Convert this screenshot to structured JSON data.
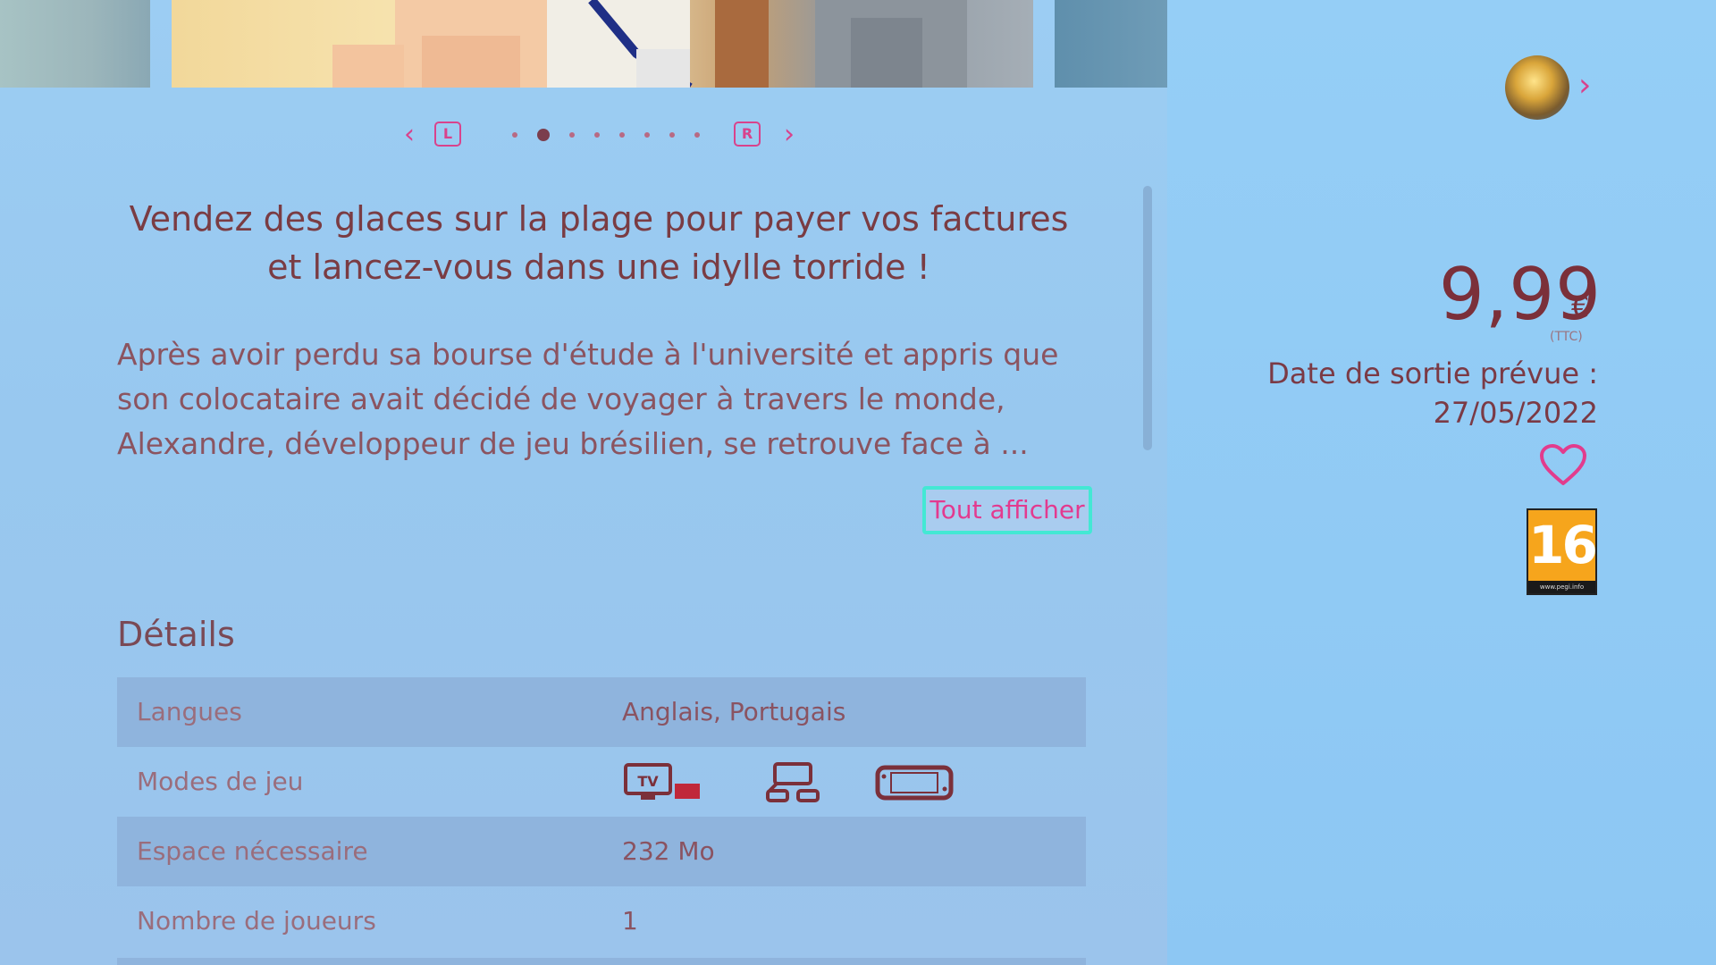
{
  "carousel": {
    "prev_chevron": "‹",
    "next_chevron": "›",
    "left_key": "L",
    "right_key": "R",
    "dot_count": 8,
    "active_index": 1
  },
  "description": {
    "tagline": "Vendez des glaces sur la plage pour payer vos factures et lancez-vous dans une idylle torride !",
    "body_lines": [
      "Après avoir perdu sa bourse d'étude à l'université et appris que",
      "son colocataire avait décidé de voyager à travers le monde,",
      "Alexandre, développeur de jeu brésilien, se retrouve face à ..."
    ],
    "show_all_label": "Tout afficher"
  },
  "details": {
    "title": "Détails",
    "rows": [
      {
        "label": "Langues",
        "value": "Anglais, Portugais"
      },
      {
        "label": "Modes de jeu",
        "value": "",
        "icons": [
          "tv-mode-icon",
          "tabletop-mode-icon",
          "handheld-mode-icon"
        ]
      },
      {
        "label": "Espace nécessaire",
        "value": "232 Mo"
      },
      {
        "label": "Nombre de joueurs",
        "value": "1"
      }
    ],
    "tv_icon_text": "TV"
  },
  "sidebar": {
    "price": "9,99",
    "currency": "€",
    "tax_note": "(TTC)",
    "release_label": "Date de sortie prévue :",
    "release_date": "27/05/2022",
    "age_rating": "16",
    "rating_footer": "www.pegi.info"
  },
  "colors": {
    "accent": "#d9428c",
    "focus_border": "#43e8d4",
    "heading_text": "#7a3c43",
    "pegi_orange": "#f6a51c"
  }
}
